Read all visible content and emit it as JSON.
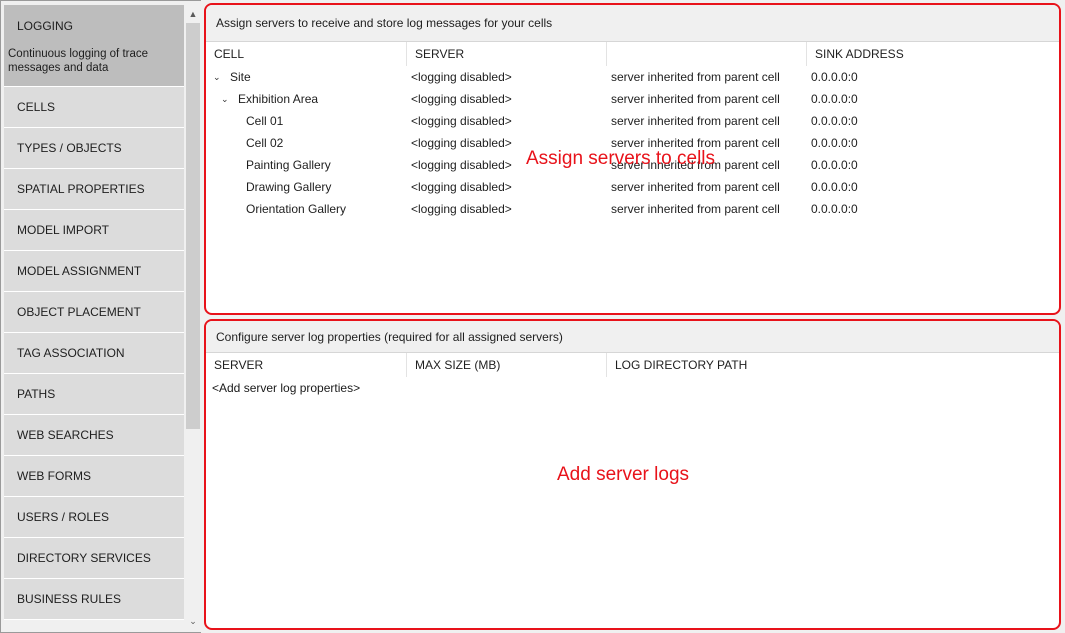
{
  "sidebar": {
    "active": {
      "label": "LOGGING",
      "description": "Continuous logging of trace messages and data"
    },
    "items": [
      {
        "label": "CELLS"
      },
      {
        "label": "TYPES / OBJECTS"
      },
      {
        "label": "SPATIAL PROPERTIES"
      },
      {
        "label": "MODEL IMPORT"
      },
      {
        "label": "MODEL ASSIGNMENT"
      },
      {
        "label": "OBJECT PLACEMENT"
      },
      {
        "label": "TAG ASSOCIATION"
      },
      {
        "label": "PATHS"
      },
      {
        "label": "WEB SEARCHES"
      },
      {
        "label": "WEB FORMS"
      },
      {
        "label": "USERS / ROLES"
      },
      {
        "label": "DIRECTORY SERVICES"
      },
      {
        "label": "BUSINESS RULES"
      }
    ],
    "scroll_up_glyph": "▲",
    "scroll_down_glyph": "⌄"
  },
  "cells_panel": {
    "title": "Assign servers to receive and store log messages for your cells",
    "columns": [
      "CELL",
      "SERVER",
      "",
      "SINK ADDRESS"
    ],
    "rows": [
      {
        "cell": "Site",
        "indent": 0,
        "expander": "⌄",
        "server": "<logging disabled>",
        "note": "server inherited from parent cell",
        "sink": "0.0.0.0:0"
      },
      {
        "cell": "Exhibition Area",
        "indent": 1,
        "expander": "⌄",
        "server": "<logging disabled>",
        "note": "server inherited from parent cell",
        "sink": "0.0.0.0:0"
      },
      {
        "cell": "Cell 01",
        "indent": 2,
        "expander": "",
        "server": "<logging disabled>",
        "note": "server inherited from parent cell",
        "sink": "0.0.0.0:0"
      },
      {
        "cell": "Cell 02",
        "indent": 2,
        "expander": "",
        "server": "<logging disabled>",
        "note": "server inherited from parent cell",
        "sink": "0.0.0.0:0"
      },
      {
        "cell": "Painting Gallery",
        "indent": 2,
        "expander": "",
        "server": "<logging disabled>",
        "note": "server inherited from parent cell",
        "sink": "0.0.0.0:0"
      },
      {
        "cell": "Drawing Gallery",
        "indent": 2,
        "expander": "",
        "server": "<logging disabled>",
        "note": "server inherited from parent cell",
        "sink": "0.0.0.0:0"
      },
      {
        "cell": "Orientation Gallery",
        "indent": 2,
        "expander": "",
        "server": "<logging disabled>",
        "note": "server inherited from parent cell",
        "sink": "0.0.0.0:0"
      }
    ],
    "annotation": "Assign servers to cells"
  },
  "servers_panel": {
    "title": "Configure server log properties (required for all assigned servers)",
    "columns": [
      "SERVER",
      "MAX SIZE (MB)",
      "LOG DIRECTORY PATH"
    ],
    "placeholder": "<Add server log properties>",
    "annotation": "Add server logs"
  },
  "colors": {
    "annotation": "#e8121a",
    "nav_item": "#dcdcdc",
    "nav_active": "#bdbdbd"
  }
}
